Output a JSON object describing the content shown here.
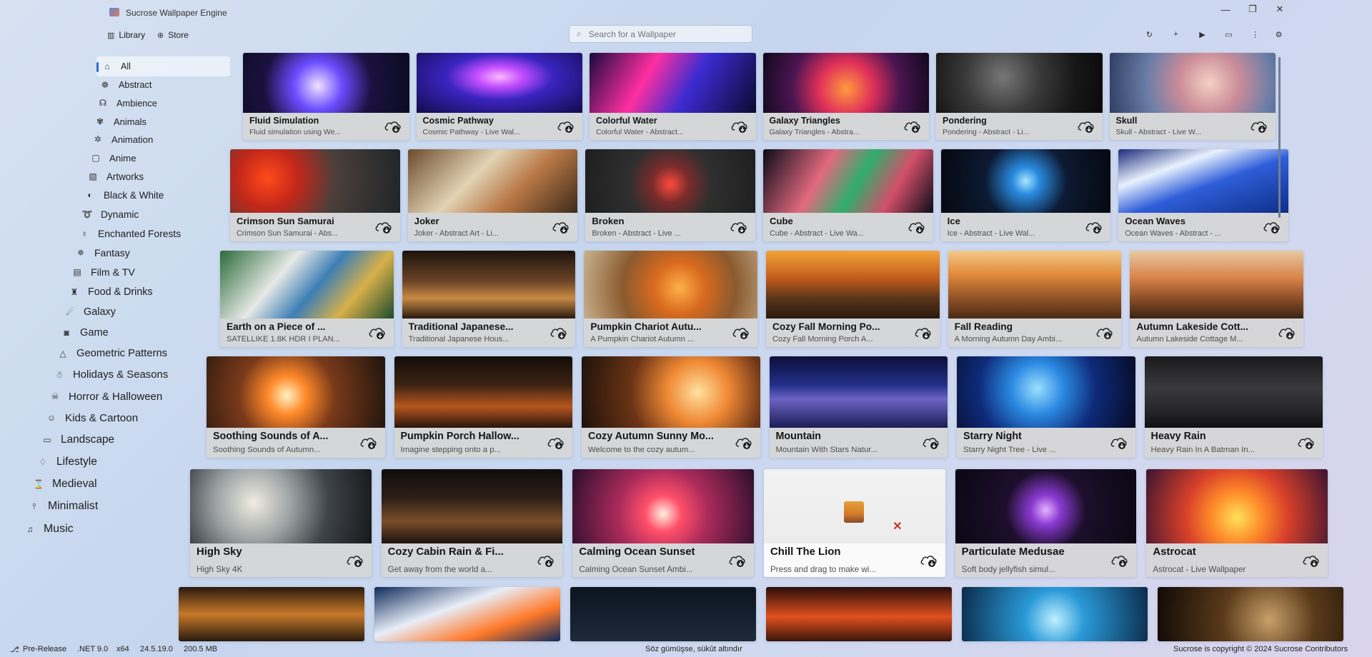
{
  "app": {
    "title": "Sucrose Wallpaper Engine",
    "nav": [
      {
        "label": "Library",
        "icon": "library-icon"
      },
      {
        "label": "Store",
        "icon": "store-icon"
      }
    ],
    "search_placeholder": "Search for a Wallpaper",
    "toolbar": [
      {
        "icon": "refresh-icon",
        "glyph": "↻"
      },
      {
        "icon": "add-icon",
        "glyph": "+"
      },
      {
        "icon": "play-icon",
        "glyph": "▶"
      },
      {
        "icon": "display-icon",
        "glyph": "▭"
      },
      {
        "icon": "more-icon",
        "glyph": "⋮"
      },
      {
        "icon": "settings-icon",
        "glyph": "⚙"
      }
    ],
    "window_controls": [
      {
        "icon": "minimize-icon",
        "glyph": "—"
      },
      {
        "icon": "maximize-icon",
        "glyph": "❐"
      },
      {
        "icon": "close-icon",
        "glyph": "✕"
      }
    ]
  },
  "sidebar": {
    "items": [
      {
        "label": "All",
        "icon": "home-icon",
        "glyph": "⌂",
        "active": true
      },
      {
        "label": "Abstract",
        "icon": "abstract-icon",
        "glyph": "☸"
      },
      {
        "label": "Ambience",
        "icon": "headphones-icon",
        "glyph": "☊"
      },
      {
        "label": "Animals",
        "icon": "paw-icon",
        "glyph": "✾"
      },
      {
        "label": "Animation",
        "icon": "sparkle-icon",
        "glyph": "✲"
      },
      {
        "label": "Anime",
        "icon": "screen-icon",
        "glyph": "▢"
      },
      {
        "label": "Artworks",
        "icon": "artworks-icon",
        "glyph": "▧"
      },
      {
        "label": "Black & White",
        "icon": "contrast-icon",
        "glyph": "◐"
      },
      {
        "label": "Dynamic",
        "icon": "dynamic-icon",
        "glyph": "➰"
      },
      {
        "label": "Enchanted Forests",
        "icon": "bell-icon",
        "glyph": "♁"
      },
      {
        "label": "Fantasy",
        "icon": "fantasy-icon",
        "glyph": "✵"
      },
      {
        "label": "Film & TV",
        "icon": "film-icon",
        "glyph": "▤"
      },
      {
        "label": "Food & Drinks",
        "icon": "food-icon",
        "glyph": "♜"
      },
      {
        "label": "Galaxy",
        "icon": "galaxy-icon",
        "glyph": "☄"
      },
      {
        "label": "Game",
        "icon": "gamepad-icon",
        "glyph": "◙"
      },
      {
        "label": "Geometric Patterns",
        "icon": "triangle-icon",
        "glyph": "△"
      },
      {
        "label": "Holidays & Seasons",
        "icon": "holidays-icon",
        "glyph": "☃"
      },
      {
        "label": "Horror & Halloween",
        "icon": "horror-icon",
        "glyph": "☠"
      },
      {
        "label": "Kids & Cartoon",
        "icon": "kids-icon",
        "glyph": "☺"
      },
      {
        "label": "Landscape",
        "icon": "landscape-icon",
        "glyph": "▭"
      },
      {
        "label": "Lifestyle",
        "icon": "lifestyle-icon",
        "glyph": "♢"
      },
      {
        "label": "Medieval",
        "icon": "medieval-icon",
        "glyph": "⌛"
      },
      {
        "label": "Minimalist",
        "icon": "minimalist-icon",
        "glyph": "⫯"
      },
      {
        "label": "Music",
        "icon": "music-icon",
        "glyph": "♫"
      }
    ]
  },
  "wallpapers": [
    {
      "title": "Fluid Simulation",
      "desc": "Fluid simulation using We...",
      "bg": "radial-gradient(circle at 45% 55%, #f0e2ff 0%, #6a4cff 25%, #1b1140 55%, #0b0b20 100%)"
    },
    {
      "title": "Cosmic Pathway",
      "desc": "Cosmic Pathway - Live Wal...",
      "bg": "radial-gradient(ellipse at 50% 40%, #ffb8ff 0%, #c24dff 20%, #3a24c0 45%, #140a4a 100%)"
    },
    {
      "title": "Colorful Water",
      "desc": "Colorful Water - Abstract...",
      "bg": "linear-gradient(120deg, #1a0a40 0%, #ff2fa0 35%, #3b2bd1 60%, #0c0a30 100%)"
    },
    {
      "title": "Galaxy Triangles",
      "desc": "Galaxy Triangles - Abstra...",
      "bg": "radial-gradient(circle at 50% 60%, #ff9a3c 0%, #e0305a 30%, #4a1550 60%, #10081c 100%)"
    },
    {
      "title": "Pondering",
      "desc": "Pondering - Abstract - Li...",
      "bg": "radial-gradient(circle at 40% 40%, #777 0%, #3a3a3a 35%, #161616 70%, #0a0a0a 100%)"
    },
    {
      "title": "Skull",
      "desc": "Skull - Abstract - Live W...",
      "bg": "radial-gradient(circle at 60% 50%, #f5d0c4 0%, #c98b98 30%, #6b7ea8 60%, #2f3d62 100%)"
    },
    {
      "title": "Crimson Sun Samurai",
      "desc": "Crimson Sun Samurai - Abs...",
      "bg": "radial-gradient(circle at 22% 45%, #ff4a1a 0%, #c3271a 22%, #4a3f3a 50%, #1f2528 100%)"
    },
    {
      "title": "Joker",
      "desc": "Joker - Abstract Art - Li...",
      "bg": "linear-gradient(135deg, #6c4b2c 0%, #e2d3b4 40%, #b87745 65%, #3d2a1a 100%)"
    },
    {
      "title": "Broken",
      "desc": "Broken - Abstract - Live ...",
      "bg": "radial-gradient(circle at 50% 55%, #ff4a3c 0%, #7a2b2b 20%, #2f2f2f 45%, #1e1e1e 100%)"
    },
    {
      "title": "Cube",
      "desc": "Cube - Abstract - Live Wa...",
      "bg": "linear-gradient(120deg, #0a0a18 0%, #e26a7e 35%, #2fae6a 55%, #d34f6a 75%, #0c0c18 100%)"
    },
    {
      "title": "Ice",
      "desc": "Ice - Abstract - Live Wal...",
      "bg": "radial-gradient(circle at 50% 50%, #a8e7ff 0%, #2a8be0 15%, #0d1a33 45%, #05080f 100%)"
    },
    {
      "title": "Ocean Waves",
      "desc": "Ocean Waves - Abstract - ...",
      "bg": "linear-gradient(160deg, #1b2a7a 0%, #e9f2ff 30%, #2e5ed8 55%, #0f2d88 100%)"
    },
    {
      "title": "Earth on a Piece of ...",
      "desc": "SATELLIKE 1.8K HDR I PLAN...",
      "bg": "linear-gradient(130deg, #2a6b38 0%, #e7e9e6 35%, #3c7fb5 55%, #d8b04a 75%, #1d4b2c 100%)"
    },
    {
      "title": "Traditional Japanese...",
      "desc": "Traditional Japanese Hous...",
      "bg": "linear-gradient(180deg, #1c130d 0%, #6b4426 45%, #c88a45 70%, #2a1a10 100%)"
    },
    {
      "title": "Pumpkin Chariot Autu...",
      "desc": "A Pumpkin Chariot Autumn ...",
      "bg": "radial-gradient(circle at 55% 55%, #ffb04a 0%, #d86a1e 25%, #8a5a2f 55%, #c9b391 100%)"
    },
    {
      "title": "Cozy Fall Morning Po...",
      "desc": "Cozy Fall Morning Porch A...",
      "bg": "linear-gradient(180deg, #f4a33a 0%, #c45d1c 40%, #5a3519 70%, #2b1a10 100%)"
    },
    {
      "title": "Fall Reading",
      "desc": "A Morning Autumn Day Ambi...",
      "bg": "linear-gradient(180deg, #f2c98a 0%, #e28b3a 35%, #9c5a2a 65%, #4a2a15 100%)"
    },
    {
      "title": "Autumn Lakeside Cott...",
      "desc": "Autumn Lakeside Cottage M...",
      "bg": "linear-gradient(180deg, #e7c9a2 0%, #d8834a 40%, #8d4f28 70%, #3a2415 100%)"
    },
    {
      "title": "Soothing Sounds of A...",
      "desc": "Soothing Sounds of Autumn...",
      "bg": "radial-gradient(circle at 45% 55%, #fff2c4 0%, #ff8a2a 18%, #7a3a1a 45%, #1e140d 100%)"
    },
    {
      "title": "Pumpkin Porch Hallow...",
      "desc": "Imagine stepping onto a p...",
      "bg": "linear-gradient(180deg, #120c08 0%, #3d2314 40%, #b5561e 70%, #2a160c 100%)"
    },
    {
      "title": "Cozy Autumn Sunny Mo...",
      "desc": "Welcome to the cozy autum...",
      "bg": "radial-gradient(circle at 65% 50%, #ffe1a0 0%, #f08a35 25%, #6b3416 55%, #1f120a 100%)"
    },
    {
      "title": "Mountain",
      "desc": "Mountain With Stars Natur...",
      "bg": "linear-gradient(180deg, #0d0f3a 0%, #23308a 40%, #6c63c4 60%, #1b1d55 100%)"
    },
    {
      "title": "Starry Night",
      "desc": "Starry Night Tree - Live ...",
      "bg": "radial-gradient(circle at 45% 45%, #9be0ff 0%, #2a88e0 25%, #0e2b7a 55%, #050a22 100%)"
    },
    {
      "title": "Heavy Rain",
      "desc": "Heavy Rain In A Batman In...",
      "bg": "linear-gradient(180deg, #1a1a1c 0%, #3a3a3e 45%, #26262a 75%, #111112 100%)"
    },
    {
      "title": "High Sky",
      "desc": "High Sky 4K",
      "bg": "radial-gradient(circle at 35% 45%, #f0ede0 0%, #9ea3a6 30%, #3f4448 60%, #15181b 100%)"
    },
    {
      "title": "Cozy Cabin Rain & Fi...",
      "desc": "Get away from the world a...",
      "bg": "linear-gradient(180deg, #0f0c0a 0%, #2e2018 40%, #7a4e2a 70%, #1b130e 100%)"
    },
    {
      "title": "Calming Ocean Sunset",
      "desc": "Calming Ocean Sunset Ambi...",
      "bg": "radial-gradient(circle at 50% 60%, #fff0e0 0%, #ff4f6a 18%, #a82a5a 45%, #2a0f2c 100%)"
    },
    {
      "title": "Chill The Lion",
      "desc": "Press and drag to make wi...",
      "bg": "linear-gradient(180deg, #f2f2f2 0%, #ececec 100%)",
      "light": true
    },
    {
      "title": "Particulate Medusae",
      "desc": "Soft body jellyfish simul...",
      "bg": "radial-gradient(circle at 50% 55%, #e4b2ff 0%, #8a3ad1 15%, #1d0f2c 40%, #0a0712 100%)"
    },
    {
      "title": "Astrocat",
      "desc": "Astrocat - Live Wallpaper",
      "bg": "radial-gradient(circle at 50% 65%, #ffe15a 0%, #ff8a2a 25%, #d8402a 50%, #3a1430 100%)"
    },
    {
      "title": "",
      "desc": "",
      "bg": "linear-gradient(180deg, #2a1a0e 0%, #c77a2a 50%, #2a1a0e 100%)",
      "partial": true
    },
    {
      "title": "",
      "desc": "",
      "bg": "linear-gradient(160deg, #0f2a5a 0%, #e8eef8 40%, #ff7a2a 70%, #0f2a5a 100%)",
      "partial": true
    },
    {
      "title": "",
      "desc": "",
      "bg": "linear-gradient(180deg, #0c1420 0%, #1c2a3a 100%)",
      "partial": true
    },
    {
      "title": "",
      "desc": "",
      "bg": "linear-gradient(180deg, #2a0f0a 0%, #e0501e 55%, #3a150a 100%)",
      "partial": true
    },
    {
      "title": "",
      "desc": "",
      "bg": "radial-gradient(circle at 50% 60%, #bff0ff 0%, #2a9ad8 30%, #0a2a4a 100%)",
      "partial": true
    },
    {
      "title": "",
      "desc": "",
      "bg": "radial-gradient(circle at 60% 60%, #c9a06a 0%, #5a3a1a 40%, #0f0a06 100%)",
      "partial": true
    }
  ],
  "status": {
    "release": "Pre-Release",
    "dotnet": ".NET 9.0",
    "arch": "x64",
    "version": "24.5.19.0",
    "memory": "200.5 MB",
    "quote": "Söz gümüşse, sükût altındır",
    "copyright": "Sucrose is copyright © 2024 Sucrose Contributors"
  }
}
